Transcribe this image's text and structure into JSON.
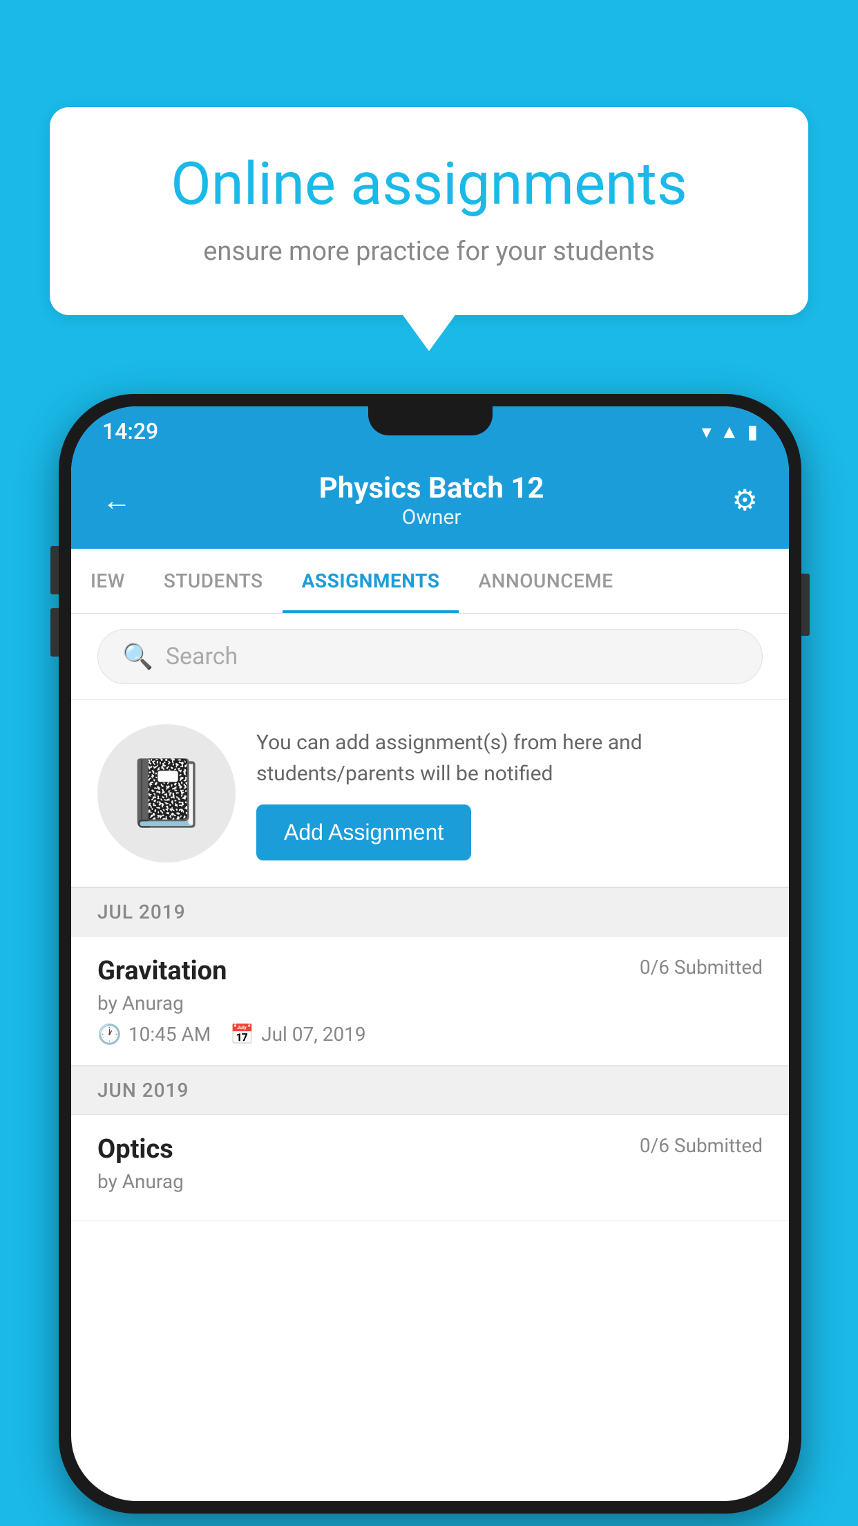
{
  "background": {
    "color": "#1ab9e8"
  },
  "speech_bubble": {
    "title": "Online assignments",
    "subtitle": "ensure more practice for your students"
  },
  "phone": {
    "status_bar": {
      "time": "14:29"
    },
    "header": {
      "title": "Physics Batch 12",
      "subtitle": "Owner",
      "back_label": "←",
      "settings_label": "⚙"
    },
    "tabs": [
      {
        "label": "IEW",
        "active": false
      },
      {
        "label": "STUDENTS",
        "active": false
      },
      {
        "label": "ASSIGNMENTS",
        "active": true
      },
      {
        "label": "ANNOUNCEME",
        "active": false
      }
    ],
    "search": {
      "placeholder": "Search"
    },
    "promo": {
      "text": "You can add assignment(s) from here and students/parents will be notified",
      "button_label": "Add Assignment"
    },
    "sections": [
      {
        "label": "JUL 2019",
        "assignments": [
          {
            "name": "Gravitation",
            "submitted": "0/6 Submitted",
            "author": "by Anurag",
            "time": "10:45 AM",
            "date": "Jul 07, 2019"
          }
        ]
      },
      {
        "label": "JUN 2019",
        "assignments": [
          {
            "name": "Optics",
            "submitted": "0/6 Submitted",
            "author": "by Anurag",
            "time": "",
            "date": ""
          }
        ]
      }
    ]
  }
}
